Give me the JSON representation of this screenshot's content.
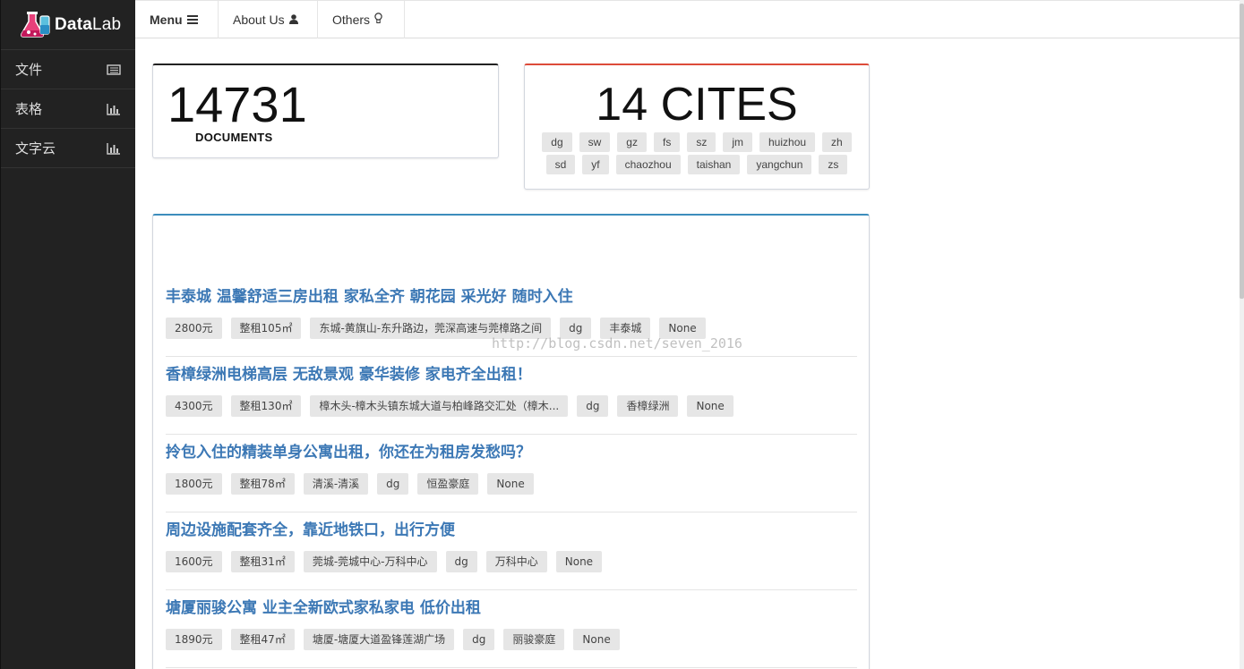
{
  "brand": {
    "name_bold": "Data",
    "name_light": "Lab",
    "logo_icon": "flask-icon"
  },
  "sidebar": {
    "items": [
      {
        "label": "文件",
        "icon": "list-icon"
      },
      {
        "label": "表格",
        "icon": "bar-chart-icon"
      },
      {
        "label": "文字云",
        "icon": "bar-chart-icon"
      }
    ]
  },
  "topnav": {
    "menu_label": "Menu",
    "menu_icon": "bars-icon",
    "about_label": "About Us",
    "about_icon": "user-icon",
    "others_label": "Others",
    "others_icon": "lightbulb-icon"
  },
  "stats": {
    "documents_count": "14731",
    "documents_label": "DOCUMENTS",
    "cites_title": "14 CITES",
    "cities": [
      "dg",
      "sw",
      "gz",
      "fs",
      "sz",
      "jm",
      "huizhou",
      "zh",
      "sd",
      "yf",
      "chaozhou",
      "taishan",
      "yangchun",
      "zs"
    ]
  },
  "listings": [
    {
      "title": "丰泰城 温馨舒适三房出租 家私全齐 朝花园 采光好 随时入住",
      "tags": [
        "2800元",
        "整租105㎡",
        "东城-黄旗山-东升路边，莞深高速与莞樟路之间",
        "dg",
        "丰泰城",
        "None"
      ]
    },
    {
      "title": "香樟绿洲电梯高层 无敌景观 豪华装修 家电齐全出租！",
      "tags": [
        "4300元",
        "整租130㎡",
        "樟木头-樟木头镇东城大道与柏峰路交汇处（樟木...",
        "dg",
        "香樟绿洲",
        "None"
      ]
    },
    {
      "title": "拎包入住的精装单身公寓出租，你还在为租房发愁吗？",
      "tags": [
        "1800元",
        "整租78㎡",
        "清溪-清溪",
        "dg",
        "恒盈豪庭",
        "None"
      ]
    },
    {
      "title": "周边设施配套齐全，靠近地铁口，出行方便",
      "tags": [
        "1600元",
        "整租31㎡",
        "莞城-莞城中心-万科中心",
        "dg",
        "万科中心",
        "None"
      ]
    },
    {
      "title": "塘厦丽骏公寓 业主全新欧式家私家电 低价出租",
      "tags": [
        "1890元",
        "整租47㎡",
        "塘厦-塘厦大道盈锋莲湖广场",
        "dg",
        "丽骏豪庭",
        "None"
      ]
    }
  ],
  "watermark": "http://blog.csdn.net/seven_2016",
  "colors": {
    "sidebar_bg": "#222222",
    "link_blue": "#3c78b5",
    "box_red": "#dd4b39",
    "box_blue": "#3c8dbc"
  }
}
